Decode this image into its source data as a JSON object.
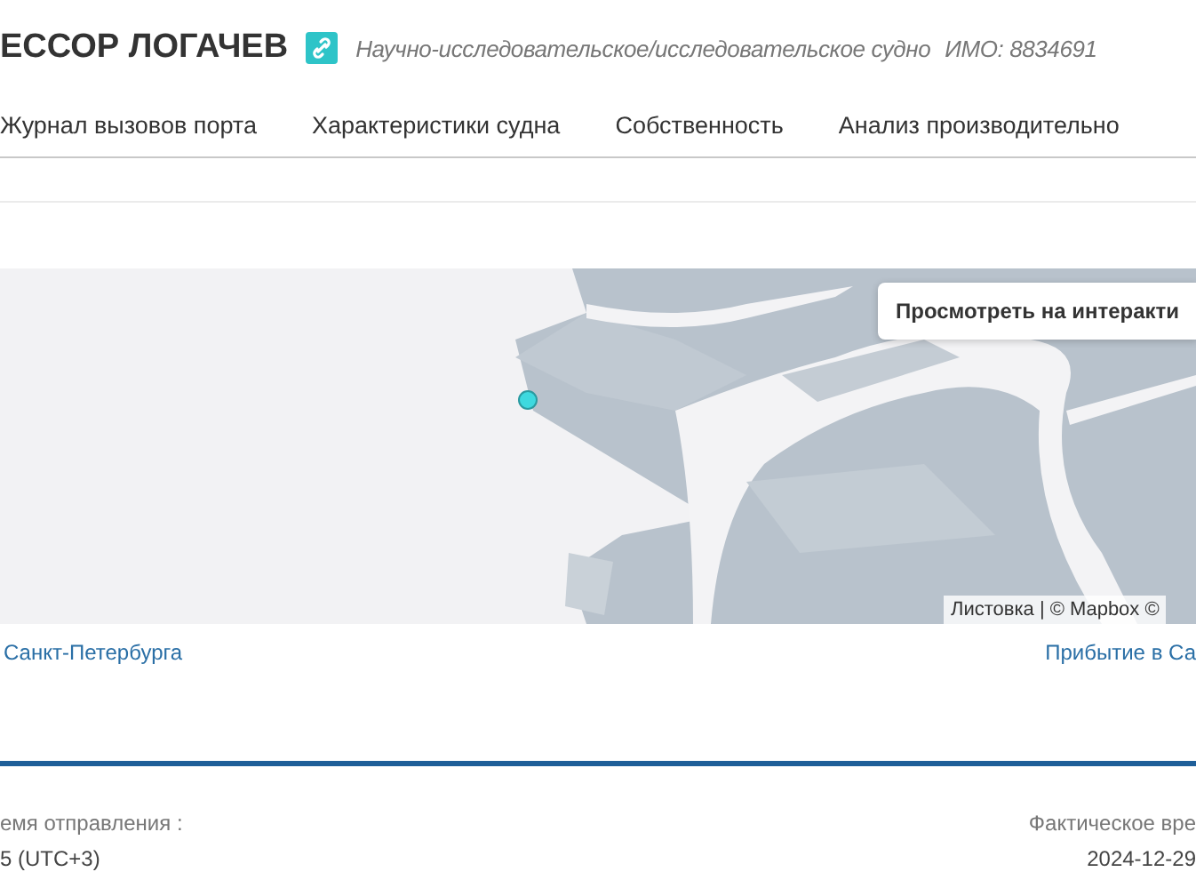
{
  "header": {
    "title": "ЕССОР ЛОГАЧЕВ",
    "vessel_type": "Научно-исследовательское/исследовательское судно",
    "imo": "ИМО: 8834691"
  },
  "tabs": [
    {
      "label": "Журнал вызовов порта",
      "selected": false
    },
    {
      "label": "Характеристики судна",
      "selected": false
    },
    {
      "label": "Собственность",
      "selected": false
    },
    {
      "label": "Анализ производительно",
      "selected": false
    }
  ],
  "map": {
    "view_button": "Просмотреть на интеракти",
    "attribution": "Листовка | © Mapbox ©"
  },
  "route_links": [
    "Санкт-Петербурга",
    "Прибытие в Са"
  ],
  "times": [
    {
      "label": "емя отправления :",
      "value": "5 (UTC+3)"
    },
    {
      "label": "Фактическое вре",
      "value": "2024-12-29"
    }
  ]
}
